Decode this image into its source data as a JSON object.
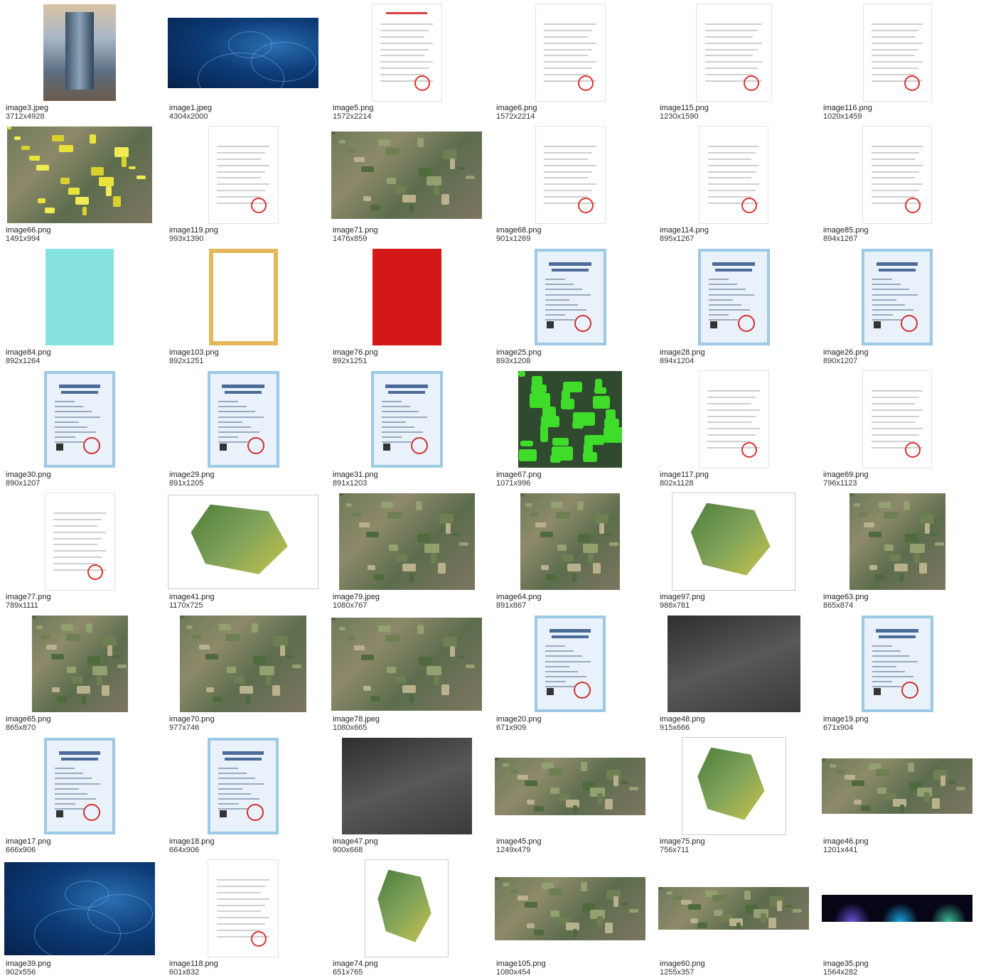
{
  "files": [
    {
      "name": "image3.jpeg",
      "dims": "3712x4928",
      "kind": "photo"
    },
    {
      "name": "image1.jpeg",
      "dims": "4304x2000",
      "kind": "tech"
    },
    {
      "name": "image5.png",
      "dims": "1572x2214",
      "kind": "doc-red"
    },
    {
      "name": "image6.png",
      "dims": "1572x2214",
      "kind": "doc"
    },
    {
      "name": "image115.png",
      "dims": "1230x1590",
      "kind": "doc"
    },
    {
      "name": "image116.png",
      "dims": "1020x1459",
      "kind": "doc"
    },
    {
      "name": "image66.png",
      "dims": "1491x994",
      "kind": "sat-yellow"
    },
    {
      "name": "image119.png",
      "dims": "993x1390",
      "kind": "doc"
    },
    {
      "name": "image71.png",
      "dims": "1476x859",
      "kind": "sat"
    },
    {
      "name": "image68.png",
      "dims": "901x1269",
      "kind": "doc"
    },
    {
      "name": "image114.png",
      "dims": "895x1267",
      "kind": "doc"
    },
    {
      "name": "image85.png",
      "dims": "894x1267",
      "kind": "doc"
    },
    {
      "name": "image84.png",
      "dims": "892x1264",
      "kind": "teal"
    },
    {
      "name": "image103.png",
      "dims": "892x1251",
      "kind": "gold"
    },
    {
      "name": "image76.png",
      "dims": "892x1251",
      "kind": "red"
    },
    {
      "name": "image25.png",
      "dims": "893x1208",
      "kind": "cert"
    },
    {
      "name": "image28.png",
      "dims": "894x1204",
      "kind": "cert"
    },
    {
      "name": "image26.png",
      "dims": "890x1207",
      "kind": "cert"
    },
    {
      "name": "image30.png",
      "dims": "890x1207",
      "kind": "cert"
    },
    {
      "name": "image29.png",
      "dims": "891x1205",
      "kind": "cert"
    },
    {
      "name": "image31.png",
      "dims": "891x1203",
      "kind": "cert"
    },
    {
      "name": "image67.png",
      "dims": "1071x996",
      "kind": "green"
    },
    {
      "name": "image117.png",
      "dims": "802x1128",
      "kind": "doc"
    },
    {
      "name": "image69.png",
      "dims": "796x1123",
      "kind": "doc"
    },
    {
      "name": "image77.png",
      "dims": "789x1111",
      "kind": "doc"
    },
    {
      "name": "image41.png",
      "dims": "1170x725",
      "kind": "map-white"
    },
    {
      "name": "image79.jpeg",
      "dims": "1080x767",
      "kind": "sat"
    },
    {
      "name": "image64.png",
      "dims": "891x867",
      "kind": "sat"
    },
    {
      "name": "image97.png",
      "dims": "988x781",
      "kind": "map-white"
    },
    {
      "name": "image63.png",
      "dims": "865x874",
      "kind": "sat"
    },
    {
      "name": "image65.png",
      "dims": "865x870",
      "kind": "sat"
    },
    {
      "name": "image70.png",
      "dims": "977x746",
      "kind": "sat"
    },
    {
      "name": "image78.jpeg",
      "dims": "1080x665",
      "kind": "sat"
    },
    {
      "name": "image20.png",
      "dims": "671x909",
      "kind": "cert"
    },
    {
      "name": "image48.png",
      "dims": "915x666",
      "kind": "gray"
    },
    {
      "name": "image19.png",
      "dims": "671x904",
      "kind": "cert"
    },
    {
      "name": "image17.png",
      "dims": "666x906",
      "kind": "cert"
    },
    {
      "name": "image18.png",
      "dims": "664x906",
      "kind": "cert"
    },
    {
      "name": "image47.png",
      "dims": "900x668",
      "kind": "gray"
    },
    {
      "name": "image45.png",
      "dims": "1249x479",
      "kind": "sat"
    },
    {
      "name": "image75.png",
      "dims": "756x711",
      "kind": "map-white"
    },
    {
      "name": "image46.png",
      "dims": "1201x441",
      "kind": "sat"
    },
    {
      "name": "image39.png",
      "dims": "902x556",
      "kind": "tech"
    },
    {
      "name": "image118.png",
      "dims": "601x832",
      "kind": "doc"
    },
    {
      "name": "image74.png",
      "dims": "651x765",
      "kind": "map-white"
    },
    {
      "name": "image105.png",
      "dims": "1080x454",
      "kind": "sat"
    },
    {
      "name": "image60.png",
      "dims": "1255x357",
      "kind": "sat"
    },
    {
      "name": "image35.png",
      "dims": "1564x282",
      "kind": "darkband"
    }
  ]
}
